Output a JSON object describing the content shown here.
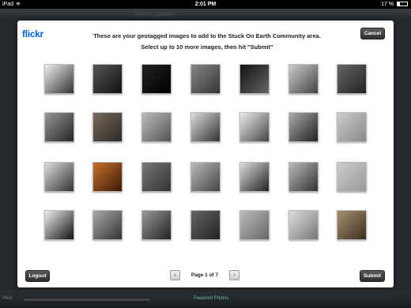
{
  "status_bar": {
    "carrier": "iPad",
    "time": "2:01 PM",
    "battery": "17 %"
  },
  "background_app": {
    "search_placeholder": "Search Location",
    "featured_label": "Featured Photos",
    "pins_label": "Pins"
  },
  "modal": {
    "logo_fl": "flickr",
    "logo_r": "",
    "instruction_line1": "These are your geotagged images to add to the Stuck On Earth Community area.",
    "instruction_line2": "Select up to 10 more images, then hit \"Submit\"",
    "cancel_label": "Cancel",
    "logout_label": "Logout",
    "submit_label": "Submit",
    "page_label": "Page 1 of 7",
    "prev_glyph": "‹",
    "next_glyph": "›"
  },
  "thumbnails": [
    {
      "tone": [
        "#eee",
        "#333"
      ]
    },
    {
      "tone": [
        "#555",
        "#111"
      ]
    },
    {
      "tone": [
        "#222",
        "#000"
      ]
    },
    {
      "tone": [
        "#888",
        "#333"
      ]
    },
    {
      "tone": [
        "#111",
        "#666"
      ]
    },
    {
      "tone": [
        "#ccc",
        "#444"
      ]
    },
    {
      "tone": [
        "#666",
        "#222"
      ]
    },
    {
      "tone": [
        "#999",
        "#222"
      ]
    },
    {
      "tone": [
        "#7a6a5a",
        "#2a2a2a"
      ]
    },
    {
      "tone": [
        "#bbb",
        "#555"
      ]
    },
    {
      "tone": [
        "#ddd",
        "#333"
      ]
    },
    {
      "tone": [
        "#eee",
        "#444"
      ]
    },
    {
      "tone": [
        "#aaa",
        "#222"
      ]
    },
    {
      "tone": [
        "#ccc",
        "#888"
      ]
    },
    {
      "tone": [
        "#ddd",
        "#333"
      ]
    },
    {
      "tone": [
        "#c8702a",
        "#3a1a08"
      ]
    },
    {
      "tone": [
        "#777",
        "#333"
      ]
    },
    {
      "tone": [
        "#bbb",
        "#444"
      ]
    },
    {
      "tone": [
        "#ddd",
        "#222"
      ]
    },
    {
      "tone": [
        "#bbb",
        "#333"
      ]
    },
    {
      "tone": [
        "#ccc",
        "#999"
      ]
    },
    {
      "tone": [
        "#eee",
        "#111"
      ]
    },
    {
      "tone": [
        "#aaa",
        "#333"
      ]
    },
    {
      "tone": [
        "#999",
        "#222"
      ]
    },
    {
      "tone": [
        "#666",
        "#222"
      ]
    },
    {
      "tone": [
        "#bbb",
        "#666"
      ]
    },
    {
      "tone": [
        "#ddd",
        "#777"
      ]
    },
    {
      "tone": [
        "#a89070",
        "#3a3020"
      ]
    }
  ]
}
